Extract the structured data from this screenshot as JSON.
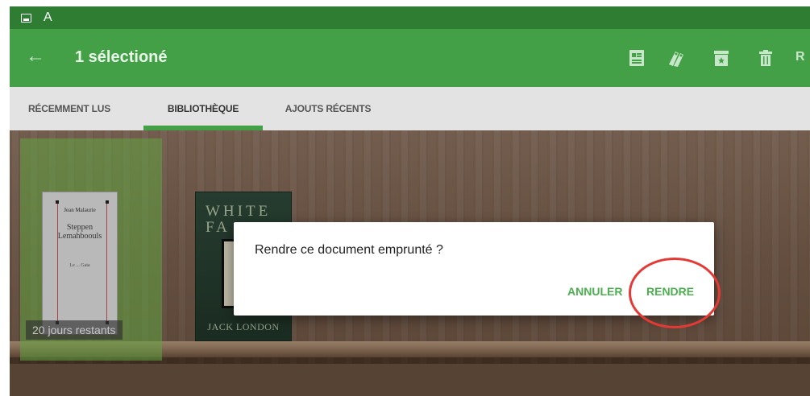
{
  "status_bar": {
    "letter": "A",
    "icon": "image-icon"
  },
  "app_bar": {
    "back_icon": "arrow-back-icon",
    "title": "1 sélectioné",
    "actions": [
      "renew-icon",
      "tags-icon",
      "archive-icon",
      "delete-icon"
    ],
    "overflow_text": "R",
    "color": "#43a047"
  },
  "tabs": [
    {
      "label": "RÉCEMMENT LUS",
      "active": false
    },
    {
      "label": "BIBLIOTHÈQUE",
      "active": true
    },
    {
      "label": "AJOUTS RÉCENTS",
      "active": false
    }
  ],
  "books": [
    {
      "author": "Jean Malaurie",
      "title": "Steppen Lemahboouls",
      "subtitle": "Le ... Gaia",
      "badge": "20 jours restants",
      "selected": true
    },
    {
      "title": "WHITE FA",
      "author": "JACK LONDON",
      "selected": false
    }
  ],
  "dialog": {
    "message": "Rendre ce document emprunté ?",
    "cancel_label": "ANNULER",
    "confirm_label": "RENDRE"
  },
  "colors": {
    "accent": "#4caf50",
    "highlight": "#e53935",
    "status_bar": "#2e7d32"
  }
}
